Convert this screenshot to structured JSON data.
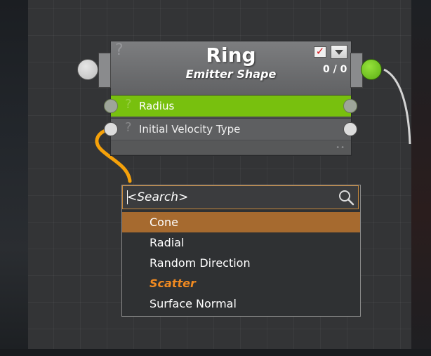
{
  "node": {
    "title": "Ring",
    "subtitle": "Emitter Shape",
    "help_glyph": "?",
    "counter": "0 / 0",
    "enabled_checkbox": "✓",
    "rows": [
      {
        "label": "Radius",
        "help_glyph": "?"
      },
      {
        "label": "Initial Velocity Type",
        "help_glyph": "?"
      }
    ],
    "footer_grip": "••"
  },
  "search": {
    "placeholder": "<Search>",
    "value": ""
  },
  "options": [
    {
      "label": "Cone",
      "state": "selected"
    },
    {
      "label": "Radial",
      "state": "normal"
    },
    {
      "label": "Random Direction",
      "state": "normal"
    },
    {
      "label": "Scatter",
      "state": "highlighted"
    },
    {
      "label": "Surface Normal",
      "state": "normal"
    }
  ],
  "colors": {
    "canvas": "#333436",
    "header": "#6d6e70",
    "active_row": "#78c00e",
    "output_port": "#6dc21c",
    "wire_orange": "#f5a10a",
    "selected_option": "#a66a2f",
    "highlight_text": "#f08a21",
    "search_border": "#c98a3c"
  },
  "icons": [
    "help-icon",
    "checkbox-icon",
    "dropdown-arrow-icon",
    "search-icon",
    "input-port-icon",
    "output-port-icon",
    "grip-icon"
  ]
}
